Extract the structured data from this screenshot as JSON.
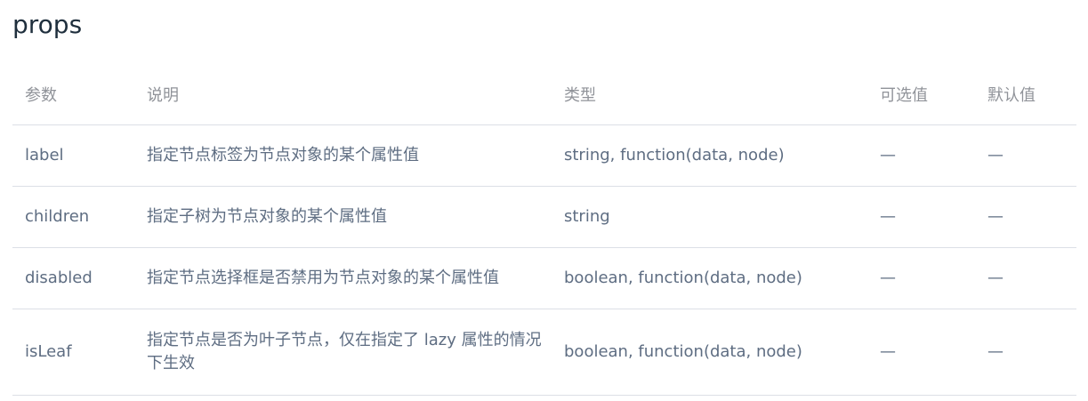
{
  "section": {
    "title": "props"
  },
  "table": {
    "headers": {
      "param": "参数",
      "description": "说明",
      "type": "类型",
      "options": "可选值",
      "default": "默认值"
    },
    "rows": [
      {
        "param": "label",
        "description": "指定节点标签为节点对象的某个属性值",
        "type": "string, function(data, node)",
        "options": "—",
        "default": "—"
      },
      {
        "param": "children",
        "description": "指定子树为节点对象的某个属性值",
        "type": "string",
        "options": "—",
        "default": "—"
      },
      {
        "param": "disabled",
        "description": "指定节点选择框是否禁用为节点对象的某个属性值",
        "type": "boolean, function(data, node)",
        "options": "—",
        "default": "—"
      },
      {
        "param": "isLeaf",
        "description": "指定节点是否为叶子节点，仅在指定了 lazy 属性的情况下生效",
        "type": "boolean, function(data, node)",
        "options": "—",
        "default": "—"
      }
    ]
  }
}
